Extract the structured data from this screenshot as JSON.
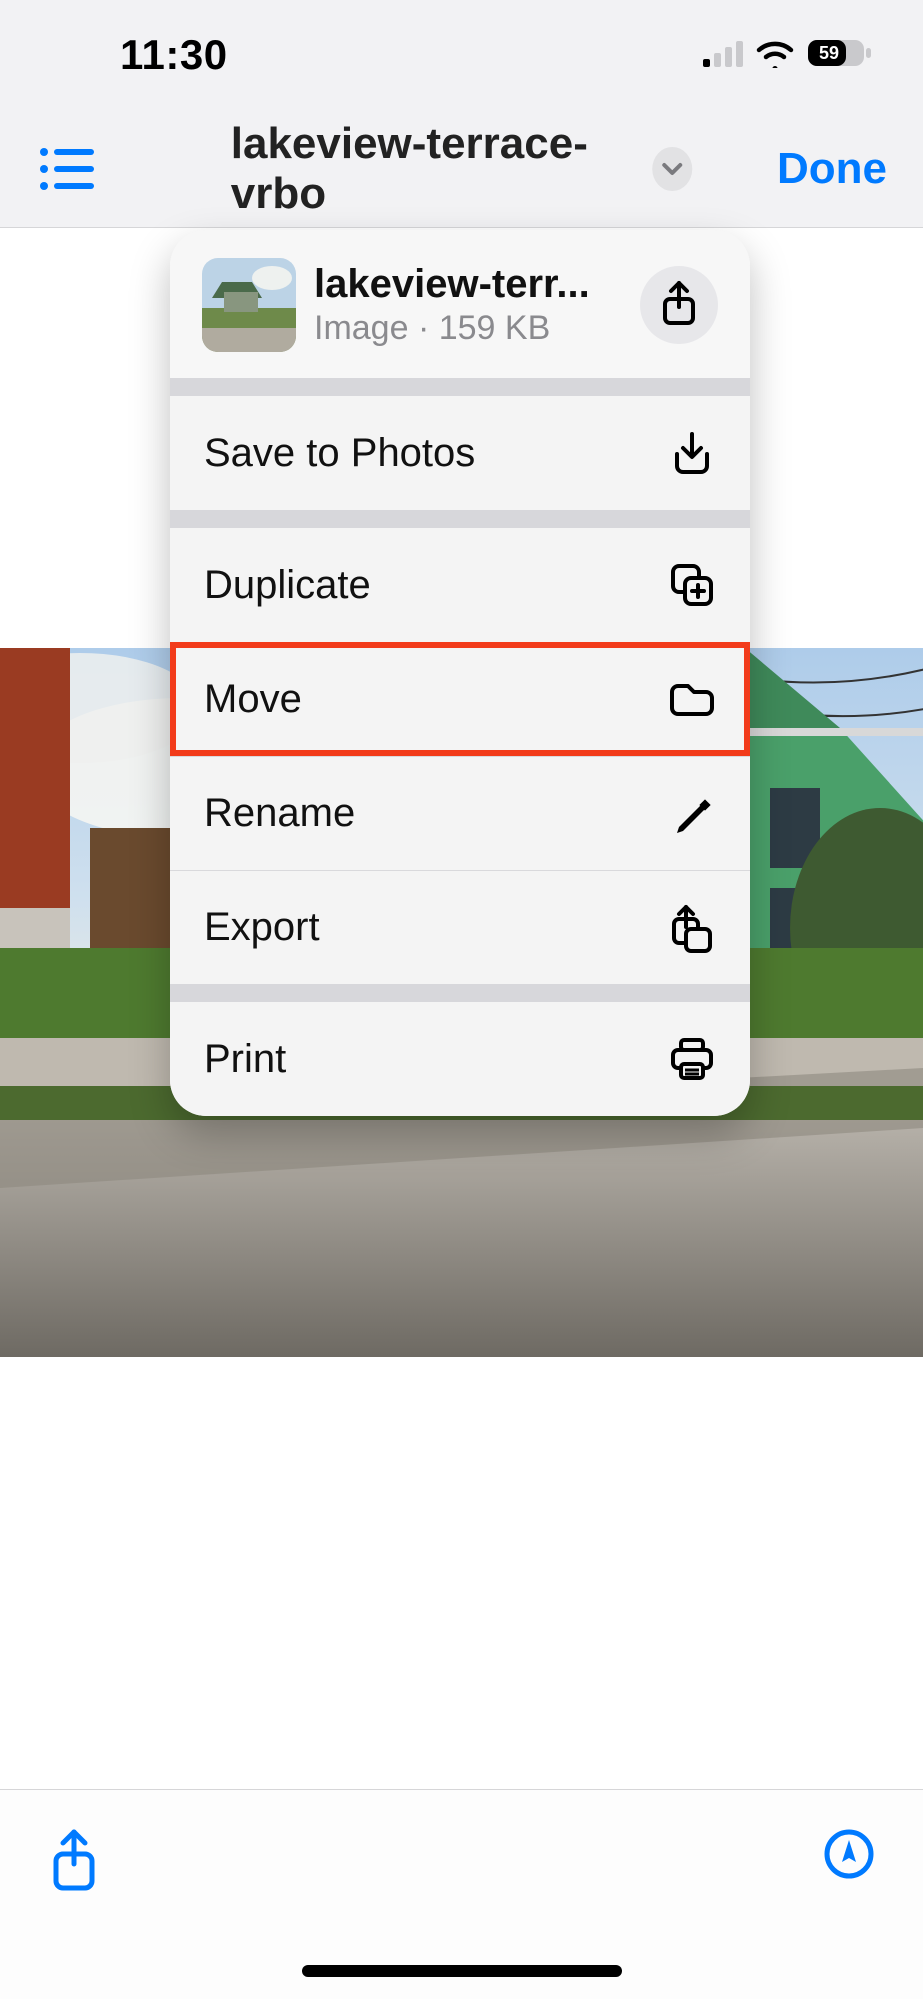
{
  "status": {
    "time": "11:30",
    "battery_level": "59"
  },
  "nav": {
    "title": "lakeview-terrace-vrbo",
    "done_label": "Done"
  },
  "dropdown": {
    "file": {
      "name_truncated": "lakeview-terr...",
      "type_label": "Image",
      "size_label": "159 KB"
    },
    "actions": {
      "save_to_photos": "Save to Photos",
      "duplicate": "Duplicate",
      "move": "Move",
      "rename": "Rename",
      "export": "Export",
      "print": "Print"
    },
    "highlighted_action": "move"
  }
}
